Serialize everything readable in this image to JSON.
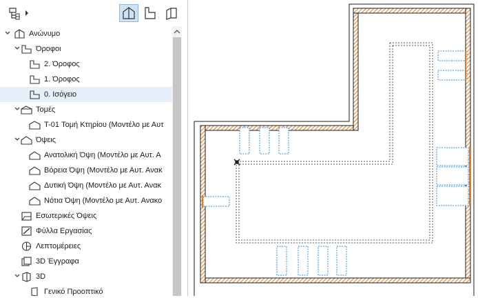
{
  "tree": [
    {
      "label": "Ανώνυμο",
      "icon": "project-icon",
      "expanded": true,
      "level": 0
    },
    {
      "label": "Όροφοι",
      "icon": "stories-folder-icon",
      "expanded": true,
      "level": 1
    },
    {
      "label": "2. Όροφος",
      "icon": "story-icon",
      "level": 2
    },
    {
      "label": "1. Όροφος",
      "icon": "story-icon",
      "level": 2
    },
    {
      "label": "0. Ισόγειο",
      "icon": "story-icon",
      "level": 2,
      "selected": true
    },
    {
      "label": "Τομές",
      "icon": "sections-folder-icon",
      "expanded": true,
      "level": 1
    },
    {
      "label": "T-01 Τομή Κτηρίου (Μοντέλο με Αυτ",
      "icon": "section-icon",
      "level": 2
    },
    {
      "label": "Όψεις",
      "icon": "elevations-folder-icon",
      "expanded": true,
      "level": 1
    },
    {
      "label": "Ανατολική Όψη (Μοντέλο με Αυτ. Α",
      "icon": "elevation-icon",
      "level": 2
    },
    {
      "label": "Βόρεια Όψη (Μοντέλο με Αυτ. Ανακ",
      "icon": "elevation-icon",
      "level": 2
    },
    {
      "label": "Δυτική Όψη (Μοντέλο με Αυτ. Ανακ",
      "icon": "elevation-icon",
      "level": 2
    },
    {
      "label": "Νότια Όψη (Μοντέλο με Αυτ. Ανακο",
      "icon": "elevation-icon",
      "level": 2
    },
    {
      "label": "Εσωτερικές Όψεις",
      "icon": "interior-elevations-icon",
      "level": 1
    },
    {
      "label": "Φύλλα Εργασίας",
      "icon": "worksheets-icon",
      "level": 1
    },
    {
      "label": "Λεπτομέρειες",
      "icon": "details-icon",
      "level": 1
    },
    {
      "label": "3D Έγγραφα",
      "icon": "3d-documents-icon",
      "level": 1
    },
    {
      "label": "3D",
      "icon": "3d-folder-icon",
      "expanded": true,
      "level": 1
    },
    {
      "label": "Γενικό Προοπτικό",
      "icon": "perspective-icon",
      "level": 2
    }
  ],
  "colors": {
    "selection": "#e5f0fb",
    "active_button": "#cfe3f7",
    "wall_hatch": "#e07a20",
    "window_blue": "#2f8be0",
    "canvas_line": "#1a1a1a"
  }
}
